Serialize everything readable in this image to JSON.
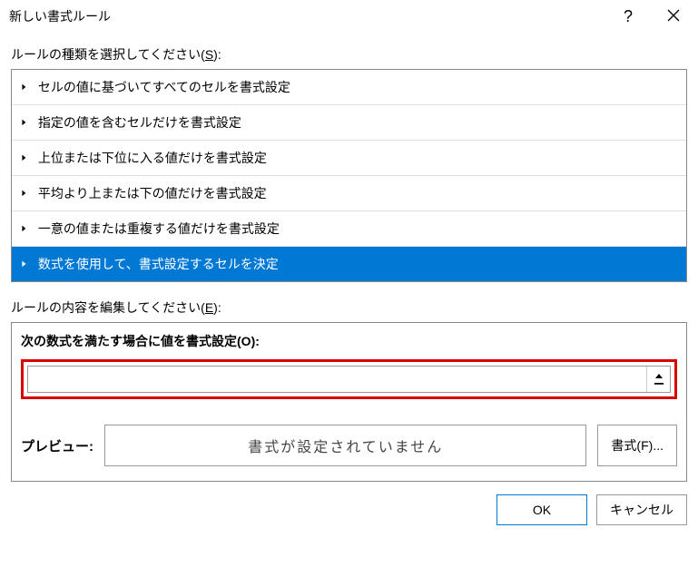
{
  "titlebar": {
    "title": "新しい書式ルール",
    "help": "?",
    "close": "×"
  },
  "rule_type_section": {
    "label_prefix": "ルールの種類を選択してください(",
    "label_hotkey": "S",
    "label_suffix": "):",
    "items": [
      "セルの値に基づいてすべてのセルを書式設定",
      "指定の値を含むセルだけを書式設定",
      "上位または下位に入る値だけを書式設定",
      "平均より上または下の値だけを書式設定",
      "一意の値または重複する値だけを書式設定",
      "数式を使用して、書式設定するセルを決定"
    ],
    "selected_index": 5
  },
  "edit_section": {
    "label_prefix": "ルールの内容を編集してください(",
    "label_hotkey": "E",
    "label_suffix": "):",
    "formula_label_prefix": "次の数式を満たす場合に値を書式設定(",
    "formula_label_hotkey": "O",
    "formula_label_suffix": "):",
    "formula_value": "",
    "preview_label": "プレビュー:",
    "preview_text": "書式が設定されていません",
    "format_button_prefix": "書式(",
    "format_button_hotkey": "F",
    "format_button_suffix": ")..."
  },
  "footer": {
    "ok": "OK",
    "cancel": "キャンセル"
  }
}
